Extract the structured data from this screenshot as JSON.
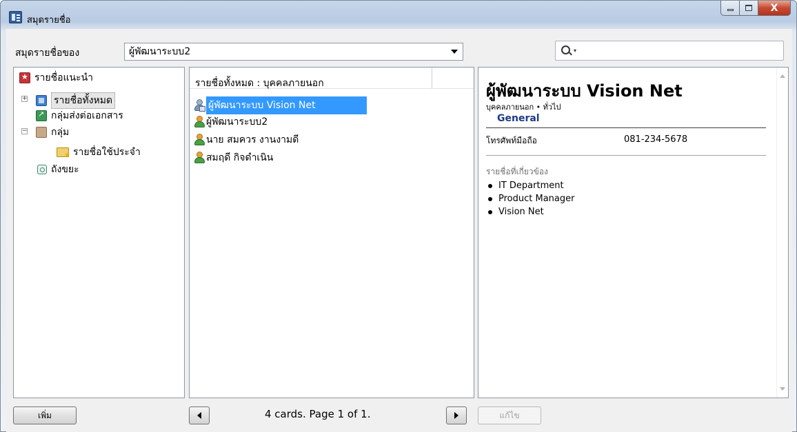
{
  "window": {
    "title": "สมุดรายชื่อ",
    "controls": {
      "minimize": "",
      "maximize": "",
      "close": "X"
    }
  },
  "toolbar": {
    "book_label": "สมุดรายชื่อของ",
    "book_selected": "ผู้พัฒนาระบบ2",
    "search_placeholder": "",
    "search_dropdown": "▾"
  },
  "tree": {
    "items": [
      {
        "label": "รายชื่อแนะนำ",
        "icon": "favorites-icon",
        "expander": ""
      },
      {
        "label": "รายชื่อทั้งหมด",
        "icon": "all-contacts-icon",
        "expander": "+"
      },
      {
        "label": "กลุ่มส่งต่อเอกสาร",
        "icon": "forward-group-icon",
        "expander": ""
      },
      {
        "label": "กลุ่ม",
        "icon": "group-icon",
        "expander": "−"
      },
      {
        "label": "รายชื่อใช้ประจำ",
        "icon": "frequent-folder-icon",
        "expander": ""
      },
      {
        "label": "ถังขยะ",
        "icon": "trash-icon",
        "expander": ""
      }
    ]
  },
  "contacts": {
    "header": "รายชื่อทั้งหมด : บุคคลภายนอก",
    "items": [
      {
        "name": "ผู้พัฒนาระบบ Vision Net",
        "selected": true
      },
      {
        "name": "ผู้พัฒนาระบบ2",
        "selected": false
      },
      {
        "name": "นาย สมควร งานงามดี",
        "selected": false
      },
      {
        "name": "สมฤดี กิจดำเนิน",
        "selected": false
      }
    ]
  },
  "card": {
    "name": "ผู้พัฒนาระบบ Vision Net",
    "subtitle": "บุคคลภายนอก • ทั่วไป",
    "section": "General",
    "phone_label": "โทรศัพท์มือถือ",
    "phone_value": "081-234-5678",
    "related_title": "รายชื่อที่เกี่ยวข้อง",
    "related": [
      "IT Department",
      "Product Manager",
      "Vision Net"
    ]
  },
  "footer": {
    "add_label": "เพิ่ม",
    "pager": "4 cards. Page 1 of 1.",
    "edit_label": "แก้ไข"
  },
  "colors": {
    "selection": "#3399ff",
    "section_title": "#1c3b86",
    "close_button": "#c74b33"
  }
}
